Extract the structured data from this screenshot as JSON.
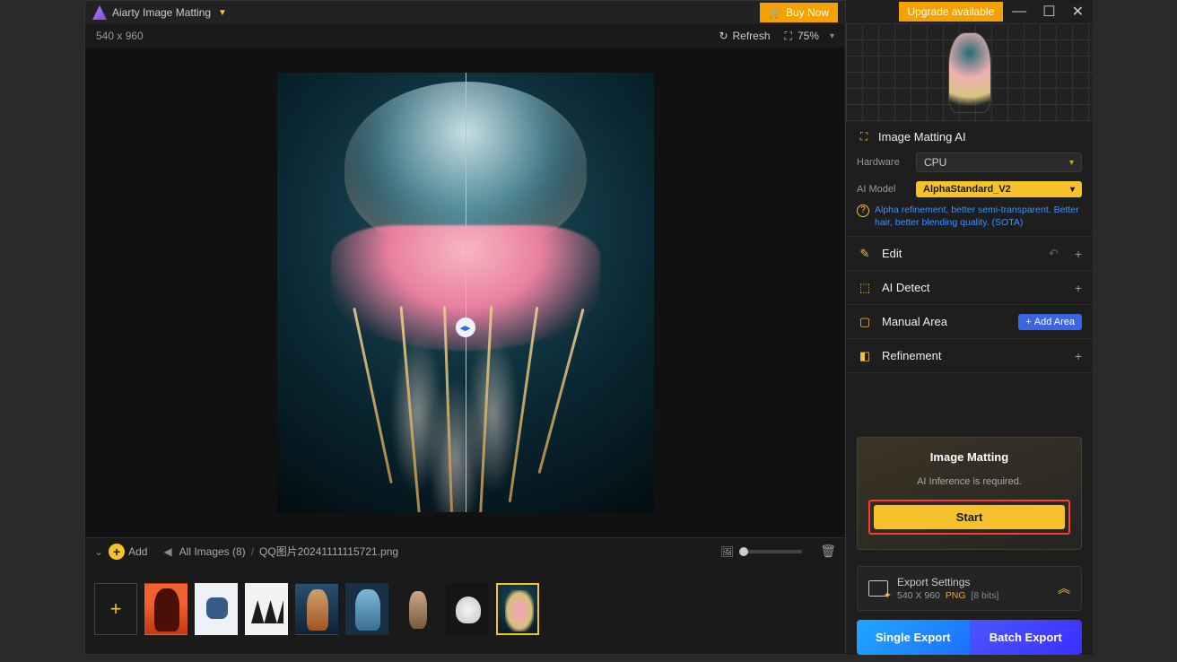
{
  "titlebar": {
    "app_name": "Aiarty Image Matting",
    "buy_label": "Buy Now",
    "upgrade_label": "Upgrade available"
  },
  "toolbar": {
    "dimensions": "540 x 960",
    "refresh": "Refresh",
    "zoom": "75%"
  },
  "footer": {
    "add_label": "Add",
    "breadcrumb_all": "All Images (8)",
    "breadcrumb_sep": "/",
    "current_file": "QQ图片20241111115721.png"
  },
  "panel": {
    "matting_title": "Image Matting AI",
    "hardware_label": "Hardware",
    "hardware_value": "CPU",
    "model_label": "AI Model",
    "model_value": "AlphaStandard_V2",
    "model_note": "Alpha refinement, better semi-transparent. Better hair, better blending quality. (SOTA)",
    "edit": "Edit",
    "ai_detect": "AI Detect",
    "manual_area": "Manual Area",
    "add_area": "Add Area",
    "refinement": "Refinement"
  },
  "start": {
    "title": "Image Matting",
    "note": "AI Inference is required.",
    "button": "Start"
  },
  "export": {
    "settings_label": "Export Settings",
    "size": "540 X 960",
    "format": "PNG",
    "bits": "[8 bits]",
    "single": "Single Export",
    "batch": "Batch Export"
  }
}
